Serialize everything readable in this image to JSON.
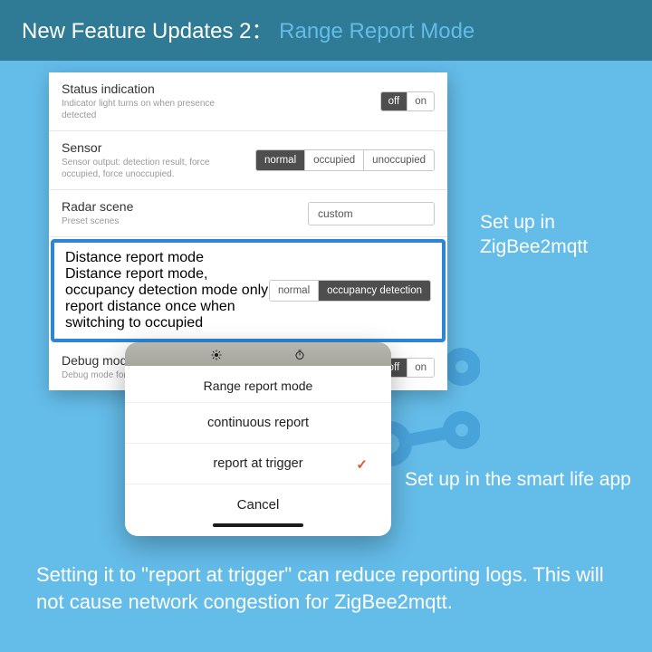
{
  "header": {
    "prefix": "New Feature Updates 2：",
    "title": "Range Report Mode"
  },
  "panel_z2m": {
    "status": {
      "label": "Status indication",
      "desc": "Indicator light turns on when presence detected",
      "options": [
        "off",
        "on"
      ],
      "selected": "off"
    },
    "sensor": {
      "label": "Sensor",
      "desc": "Sensor output: detection result, force occupied, force unoccupied.",
      "options": [
        "normal",
        "occupied",
        "unoccupied"
      ],
      "selected": "normal"
    },
    "radar": {
      "label": "Radar scene",
      "desc": "Preset scenes",
      "value": "custom"
    },
    "distance": {
      "label": "Distance report mode",
      "desc": "Distance report mode, occupancy detection mode only report distance once when switching to occupied",
      "options": [
        "normal",
        "occupancy detection"
      ],
      "selected": "occupancy detection"
    },
    "debug": {
      "label": "Debug mode",
      "desc": "Debug mode for detailed information",
      "options": [
        "off",
        "on"
      ],
      "selected": "off"
    }
  },
  "callouts": {
    "z2m": "Set up in ZigBee2mqtt",
    "app": "Set up in the smart life app"
  },
  "panel_app": {
    "title": "Range report mode",
    "items": [
      {
        "label": "continuous report",
        "selected": false
      },
      {
        "label": "report at trigger",
        "selected": true
      }
    ],
    "cancel": "Cancel"
  },
  "footer": "Setting it to \"report at trigger\" can reduce reporting logs. This will not cause network congestion for ZigBee2mqtt."
}
